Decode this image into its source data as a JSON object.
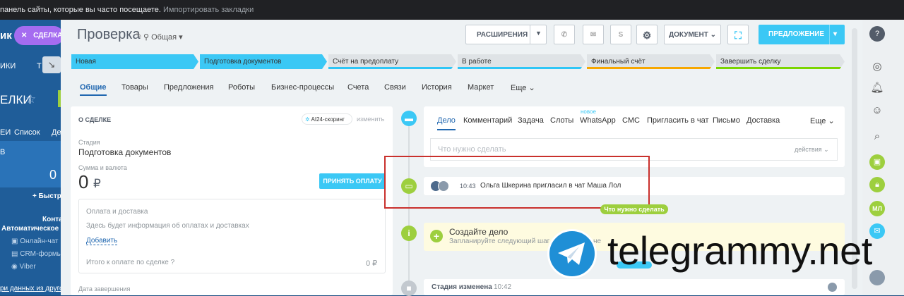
{
  "bookmarks": {
    "text": "панель сайты, которые вы часто посещаете.",
    "import": "Импортировать закладки"
  },
  "bg": {
    "deal_button": "СДЕЛКА",
    "tab_a": "ИКИ",
    "tab_b": "Т",
    "title": "ЕЛКИ",
    "list": "Список",
    "list_b": "Де",
    "zero": "0",
    "fast": "Быстр",
    "contacts": "Контакт",
    "auto": "Автоматическое до",
    "online": "Онлайн-чат",
    "crm": "CRM-формы",
    "viber": "Viber",
    "more": "ри данных из другой"
  },
  "header": {
    "title": "Проверка",
    "category": "Общая",
    "extensions": "РАСШИРЕНИЯ",
    "document": "ДОКУМЕНТ",
    "offer": "ПРЕДЛОЖЕНИЕ"
  },
  "stages": [
    {
      "label": "Новая",
      "active": true,
      "color": "#3bc8f5"
    },
    {
      "label": "Подготовка документов",
      "active": true,
      "color": "#3bc8f5"
    },
    {
      "label": "Счёт на предоплату",
      "active": false,
      "color": "#2fc6f6"
    },
    {
      "label": "В работе",
      "active": false,
      "color": "#2fc6f6"
    },
    {
      "label": "Финальный счёт",
      "active": false,
      "color": "#f7a700"
    },
    {
      "label": "Завершить сделку",
      "active": false,
      "color": "#7bd500"
    }
  ],
  "tabs": [
    "Общие",
    "Товары",
    "Предложения",
    "Роботы",
    "Бизнес-процессы",
    "Счета",
    "Связи",
    "История",
    "Маркет",
    "Еще"
  ],
  "about": {
    "heading": "О СДЕЛКЕ",
    "ai": "AI24-скоринг",
    "edit": "изменить",
    "stage_label": "Стадия",
    "stage_value": "Подготовка документов",
    "amount_label": "Сумма и валюта",
    "amount_value": "0",
    "currency": "₽",
    "pay_button": "ПРИНЯТЬ ОПЛАТУ",
    "payment_title": "Оплата и доставка",
    "payment_desc": "Здесь будет информация об оплатах и доставках",
    "add": "Добавить",
    "total_label": "Итого к оплате по сделке",
    "total_value": "0 ₽",
    "close_label": "Дата завершения"
  },
  "activity": {
    "tabs": [
      "Дело",
      "Комментарий",
      "Задача",
      "Слоты",
      "WhatsApp",
      "СМС",
      "Пригласить в чат",
      "Письмо",
      "Доставка",
      "Еще"
    ],
    "new_badge": "новое",
    "placeholder": "Что нужно сделать",
    "actions": "действия",
    "event_time": "10:43",
    "event_text": "Ольга Шкерина пригласил в чат Маша Лол",
    "pill": "Что нужно сделать",
    "create_title": "Создайте дело",
    "create_desc": "Запланируйте следующий шаг по",
    "create_desc2": "не",
    "stage_changed": "Стадия изменена",
    "stage_time": "10:42"
  },
  "watermark": "telegrammy.net",
  "rail": {
    "ml": "МЛ"
  }
}
